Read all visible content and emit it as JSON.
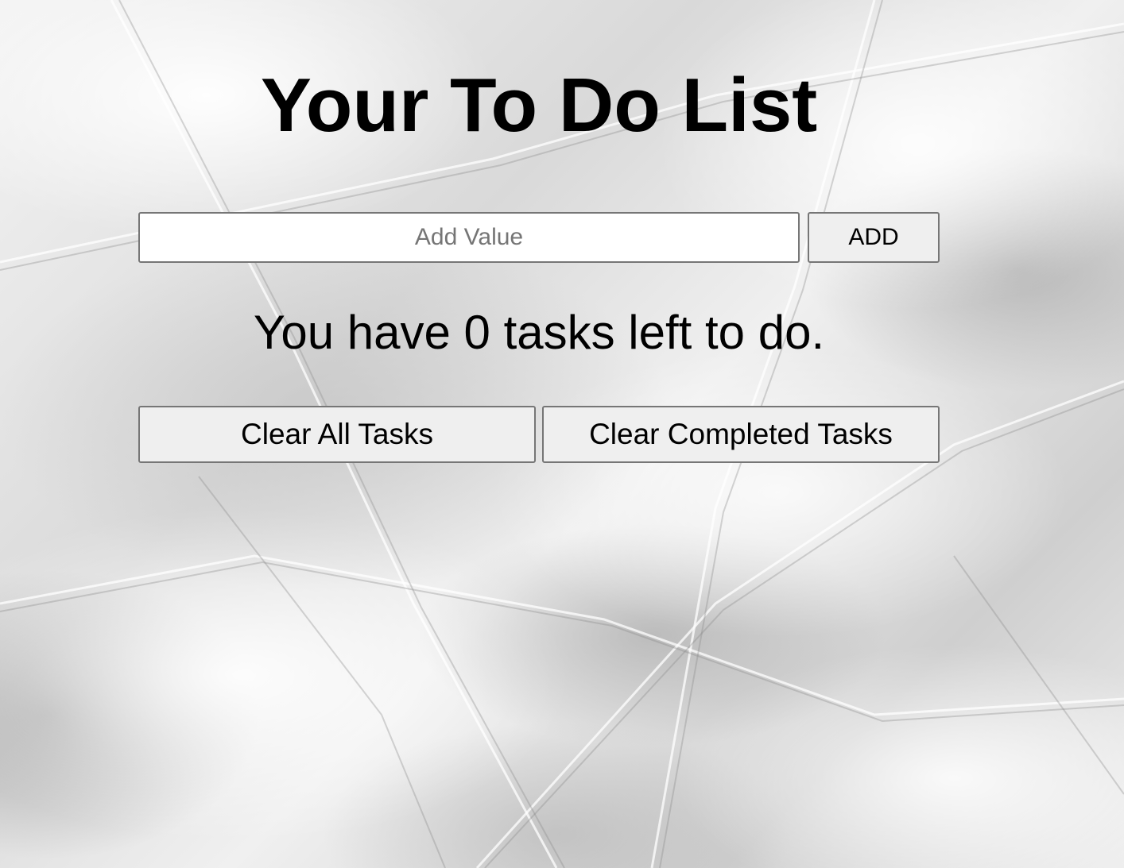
{
  "page": {
    "title": "Your To Do List"
  },
  "input": {
    "value": "",
    "placeholder": "Add Value"
  },
  "buttons": {
    "add_label": "ADD",
    "clear_all_label": "Clear All Tasks",
    "clear_completed_label": "Clear Completed Tasks"
  },
  "status": {
    "tasks_left_text": "You have 0 tasks left to do."
  },
  "colors": {
    "text": "#000000",
    "button_background": "#efefef",
    "border": "#767676",
    "placeholder": "#757575"
  }
}
